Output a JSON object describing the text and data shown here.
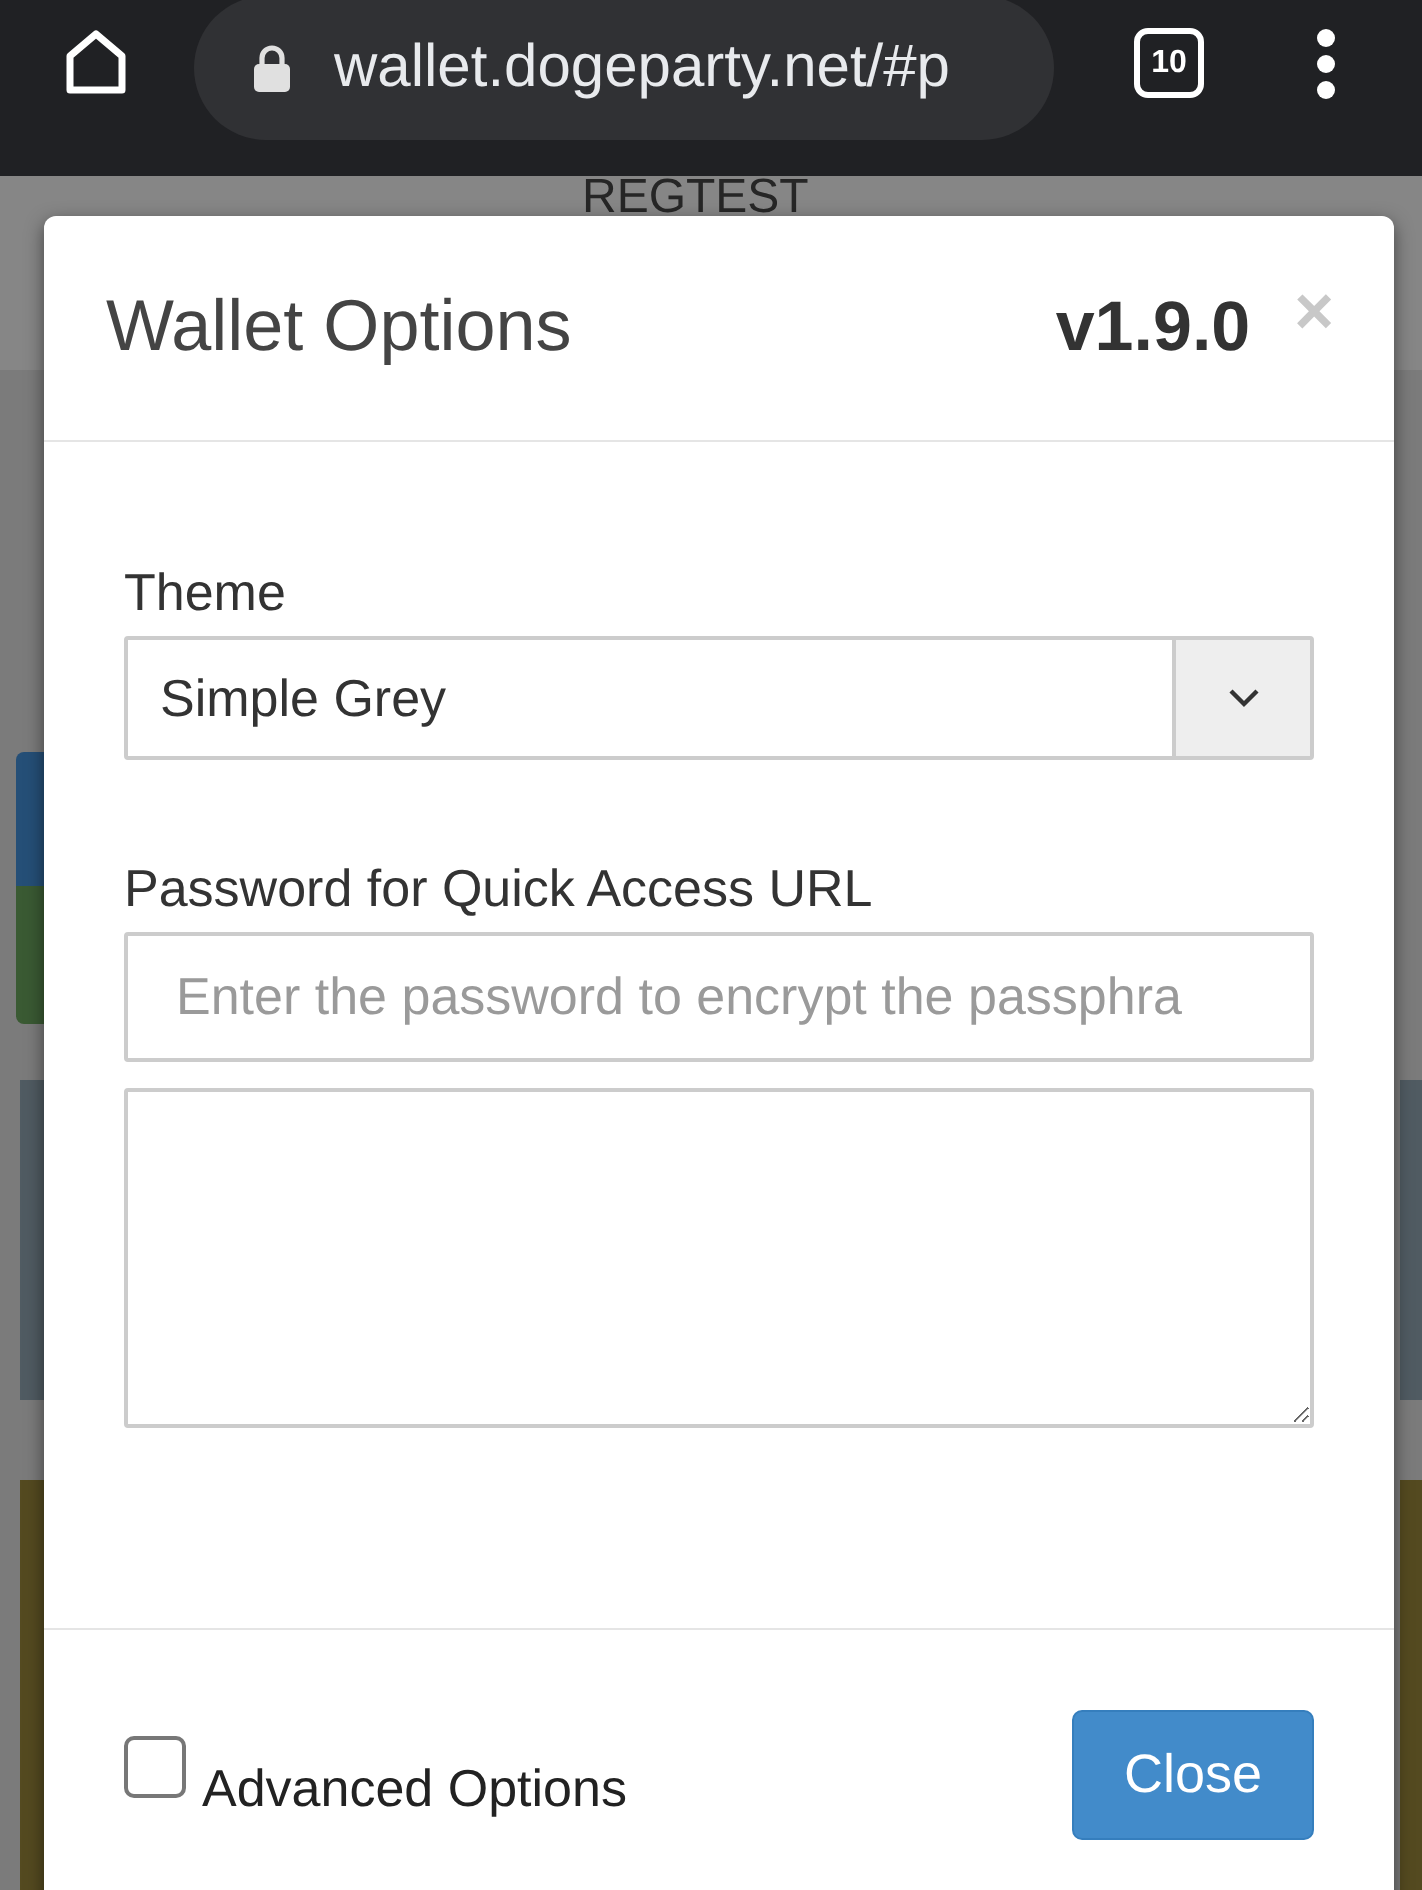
{
  "browser": {
    "address": "wallet.dogeparty.net/#p",
    "tab_count": "10"
  },
  "page": {
    "banner": "REGTEST"
  },
  "dialog": {
    "title": "Wallet Options",
    "version": "v1.9.0",
    "close_glyph": "×",
    "fields": [
      {
        "kind": "select",
        "label": "Theme",
        "value": "Simple Grey"
      },
      {
        "kind": "text",
        "label": "Password for Quick Access URL",
        "placeholder": "Enter the password to encrypt the passphra"
      },
      {
        "kind": "textarea"
      }
    ],
    "advanced_options": {
      "label": "Advanced Options",
      "checked": false
    },
    "buttons": [
      "Close"
    ]
  }
}
